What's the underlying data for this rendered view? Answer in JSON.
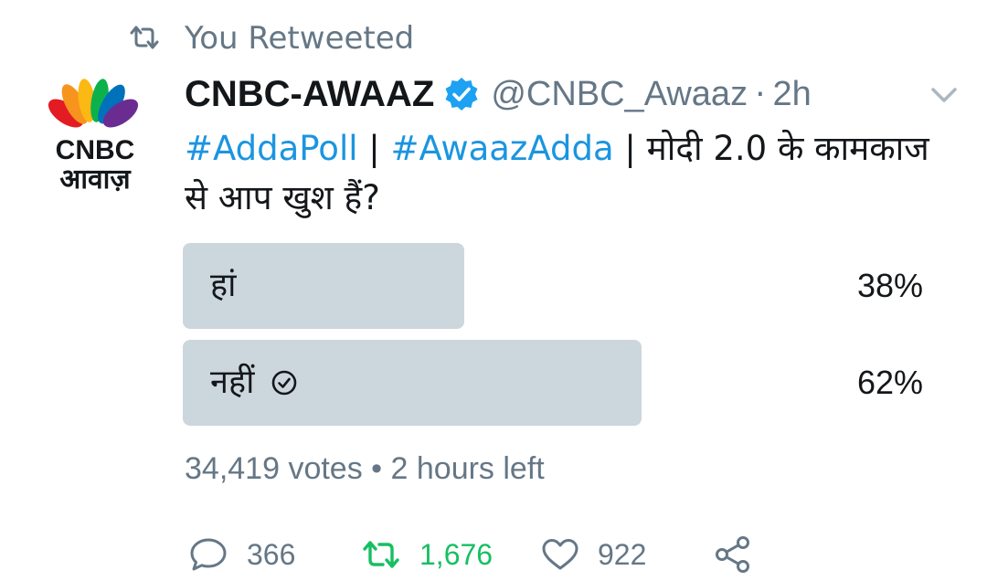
{
  "context": {
    "label": "You Retweeted",
    "icon": "retweet-icon"
  },
  "avatar": {
    "logo_top": "CNBC",
    "logo_bottom": "आवाज़",
    "icon": "cnbc-peacock-logo"
  },
  "author": {
    "name": "CNBC-AWAAZ",
    "handle": "@CNBC_Awaaz",
    "separator": "·",
    "time": "2h",
    "verified_icon": "verified-badge-icon"
  },
  "tweet": {
    "hashtag1": "#AddaPoll",
    "sep1": " | ",
    "hashtag2": "#AwaazAdda",
    "text": " | मोदी 2.0 के कामकाज से आप खुश हैं?"
  },
  "poll": {
    "options": [
      {
        "label": "हां",
        "percent_label": "38%",
        "fraction": 0.38,
        "selected": false
      },
      {
        "label": "नहीं",
        "percent_label": "62%",
        "fraction": 0.62,
        "selected": true
      }
    ],
    "votes": "34,419 votes",
    "separator": "•",
    "time_left": "2 hours left"
  },
  "actions": {
    "reply_count": "366",
    "retweet_count": "1,676",
    "like_count": "922"
  },
  "colors": {
    "accent": "#1b95e0",
    "muted": "#657786",
    "retweeted": "#17bf63",
    "poll_bar": "#ccd6dd",
    "verified": "#1da1f2"
  }
}
